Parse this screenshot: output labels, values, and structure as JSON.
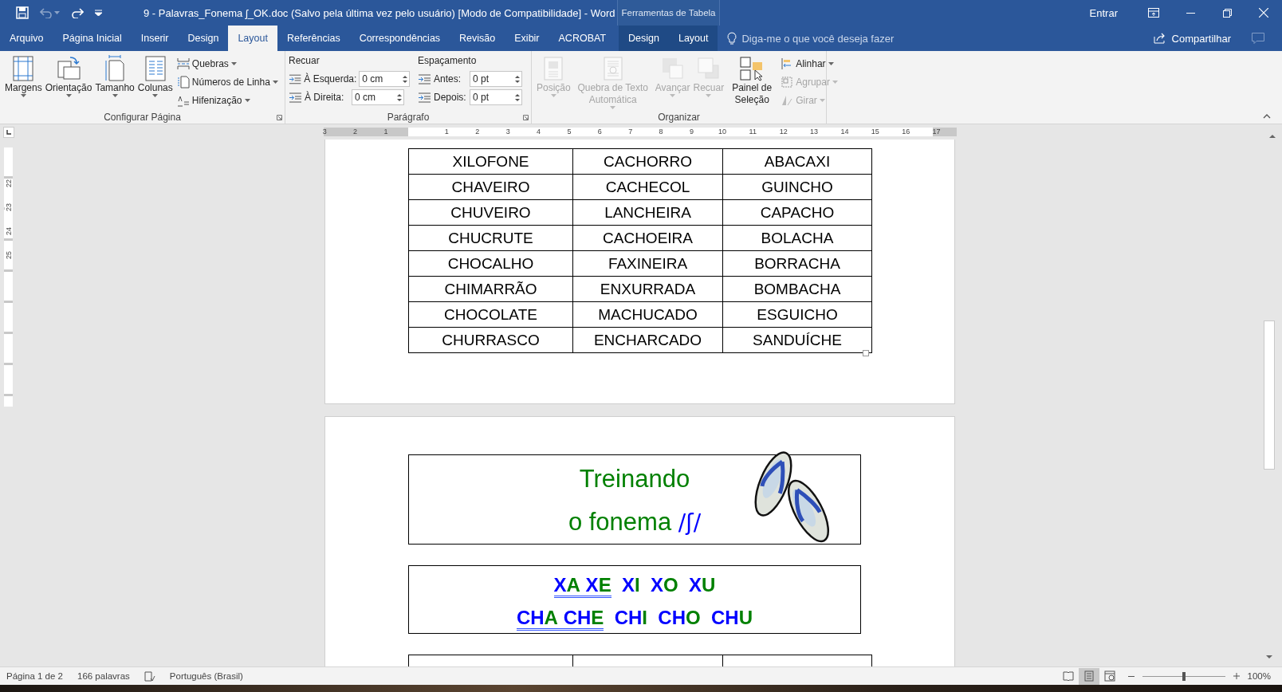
{
  "title_bar": {
    "title": "9 - Palavras_Fonema ʃ_OK.doc (Salvo pela última vez pelo usuário) [Modo de Compatibilidade]  -  Word",
    "contextual_label": "Ferramentas de Tabela",
    "sign_in": "Entrar",
    "undo_disabled": true
  },
  "tabs": [
    {
      "label": "Arquivo",
      "selected": false,
      "kind": "main"
    },
    {
      "label": "Página Inicial",
      "selected": false,
      "kind": "main"
    },
    {
      "label": "Inserir",
      "selected": false,
      "kind": "main"
    },
    {
      "label": "Design",
      "selected": false,
      "kind": "main"
    },
    {
      "label": "Layout",
      "selected": true,
      "kind": "main"
    },
    {
      "label": "Referências",
      "selected": false,
      "kind": "main"
    },
    {
      "label": "Correspondências",
      "selected": false,
      "kind": "main"
    },
    {
      "label": "Revisão",
      "selected": false,
      "kind": "main"
    },
    {
      "label": "Exibir",
      "selected": false,
      "kind": "main"
    },
    {
      "label": "ACROBAT",
      "selected": false,
      "kind": "main"
    },
    {
      "label": "Design",
      "selected": false,
      "kind": "contextual"
    },
    {
      "label": "Layout",
      "selected": false,
      "kind": "contextual"
    }
  ],
  "tell_me": {
    "placeholder": "Diga-me o que você deseja fazer"
  },
  "share": "Compartilhar",
  "ribbon": {
    "page_setup": {
      "title": "Configurar Página",
      "large_buttons": [
        {
          "label": "Margens"
        },
        {
          "label": "Orientação"
        },
        {
          "label": "Tamanho"
        },
        {
          "label": "Colunas"
        }
      ],
      "small_buttons": [
        {
          "label": "Quebras"
        },
        {
          "label": "Números de Linha"
        },
        {
          "label": "Hifenização"
        }
      ]
    },
    "paragraph": {
      "title": "Parágrafo",
      "indent": {
        "heading": "Recuar",
        "fields": [
          {
            "label": "À Esquerda:",
            "value": "0 cm"
          },
          {
            "label": "À Direita:",
            "value": "0 cm"
          }
        ]
      },
      "spacing": {
        "heading": "Espaçamento",
        "fields": [
          {
            "label": "Antes:",
            "value": "0 pt"
          },
          {
            "label": "Depois:",
            "value": "0 pt"
          }
        ]
      }
    },
    "arrange": {
      "title": "Organizar",
      "large_buttons": [
        {
          "label": "Posição",
          "disabled": true
        },
        {
          "label": "Quebra de Texto Automática",
          "disabled": true
        },
        {
          "label": "Avançar",
          "disabled": true
        },
        {
          "label": "Recuar",
          "disabled": true
        },
        {
          "label": "Painel de Seleção",
          "disabled": false
        }
      ],
      "small_buttons": [
        {
          "label": "Alinhar",
          "disabled": false
        },
        {
          "label": "Agrupar",
          "disabled": true
        },
        {
          "label": "Girar",
          "disabled": true
        }
      ]
    }
  },
  "ruler": {
    "numbers": [
      "3",
      "2",
      "1",
      "1",
      "2",
      "3",
      "4",
      "5",
      "6",
      "7",
      "8",
      "9",
      "10",
      "11",
      "12",
      "13",
      "14",
      "15",
      "16",
      "17"
    ],
    "vertical_numbers": [
      "22",
      "23",
      "24",
      "25"
    ]
  },
  "document": {
    "word_table": {
      "rows": [
        [
          "XILOFONE",
          "CACHORRO",
          "ABACAXI"
        ],
        [
          "CHAVEIRO",
          "CACHECOL",
          "GUINCHO"
        ],
        [
          "CHUVEIRO",
          "LANCHEIRA",
          "CAPACHO"
        ],
        [
          "CHUCRUTE",
          "CACHOEIRA",
          "BOLACHA"
        ],
        [
          "CHOCALHO",
          "FAXINEIRA",
          "BORRACHA"
        ],
        [
          "CHIMARRÃO",
          "ENXURRADA",
          "BOMBACHA"
        ],
        [
          "CHOCOLATE",
          "MACHUCADO",
          "ESGUICHO"
        ],
        [
          "CHURRASCO",
          "ENCHARCADO",
          "SANDUÍCHE"
        ]
      ]
    },
    "title_box": {
      "line_1": "Treinando",
      "line_2": "o fonema",
      "phoneme": "/ʃ/"
    },
    "syllable_box": {
      "lines": [
        {
          "syllables": [
            {
              "consonant": "X",
              "vowel": "A",
              "underlined": true
            },
            {
              "consonant": "X",
              "vowel": "E",
              "underlined": true
            },
            {
              "consonant": "X",
              "vowel": "I",
              "underlined": false
            },
            {
              "consonant": "X",
              "vowel": "O",
              "underlined": false
            },
            {
              "consonant": "X",
              "vowel": "U",
              "underlined": false
            }
          ]
        },
        {
          "syllables": [
            {
              "consonant": "CH",
              "vowel": "A",
              "underlined": true
            },
            {
              "consonant": "CH",
              "vowel": "E",
              "underlined": true
            },
            {
              "consonant": "CH",
              "vowel": "I",
              "underlined": false
            },
            {
              "consonant": "CH",
              "vowel": "O",
              "underlined": false
            },
            {
              "consonant": "CH",
              "vowel": "U",
              "underlined": false
            }
          ]
        }
      ]
    }
  },
  "status_bar": {
    "page": "Página 1 de 2",
    "words": "166 palavras",
    "language": "Português (Brasil)",
    "views": [
      {
        "kind": "read",
        "selected": false
      },
      {
        "kind": "print",
        "selected": true
      },
      {
        "kind": "web",
        "selected": false
      }
    ],
    "zoom": {
      "level": 0.5,
      "reading": "100%"
    }
  }
}
